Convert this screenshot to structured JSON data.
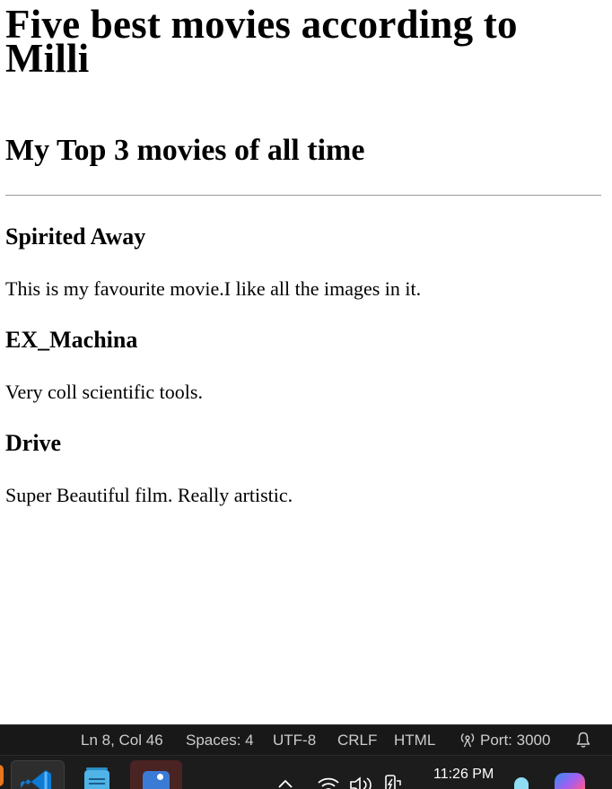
{
  "page": {
    "title": "Five best movies according to Milli",
    "subtitle": "My Top 3 movies of all time",
    "movies": [
      {
        "title": "Spirited Away",
        "description": "This is my favourite movie.I like all the images in it."
      },
      {
        "title": "EX_Machina",
        "description": "Very coll scientific tools."
      },
      {
        "title": "Drive",
        "description": "Super Beautiful film. Really artistic."
      }
    ]
  },
  "statusbar": {
    "position": "Ln 8, Col 46",
    "spaces": "Spaces: 4",
    "encoding": "UTF-8",
    "eol": "CRLF",
    "language": "HTML",
    "port": "Port: 3000",
    "port_icon": "broadcast-icon",
    "bell_icon": "bell-icon",
    "background": "#181818",
    "text_color": "#cccccc"
  },
  "taskbar": {
    "clock": "11:26 PM",
    "apps": [
      "vscode-icon",
      "notepad-icon",
      "photos-icon"
    ],
    "tray_icons": [
      "chevron-up-icon",
      "wifi-icon",
      "volume-icon",
      "battery-icon"
    ]
  }
}
